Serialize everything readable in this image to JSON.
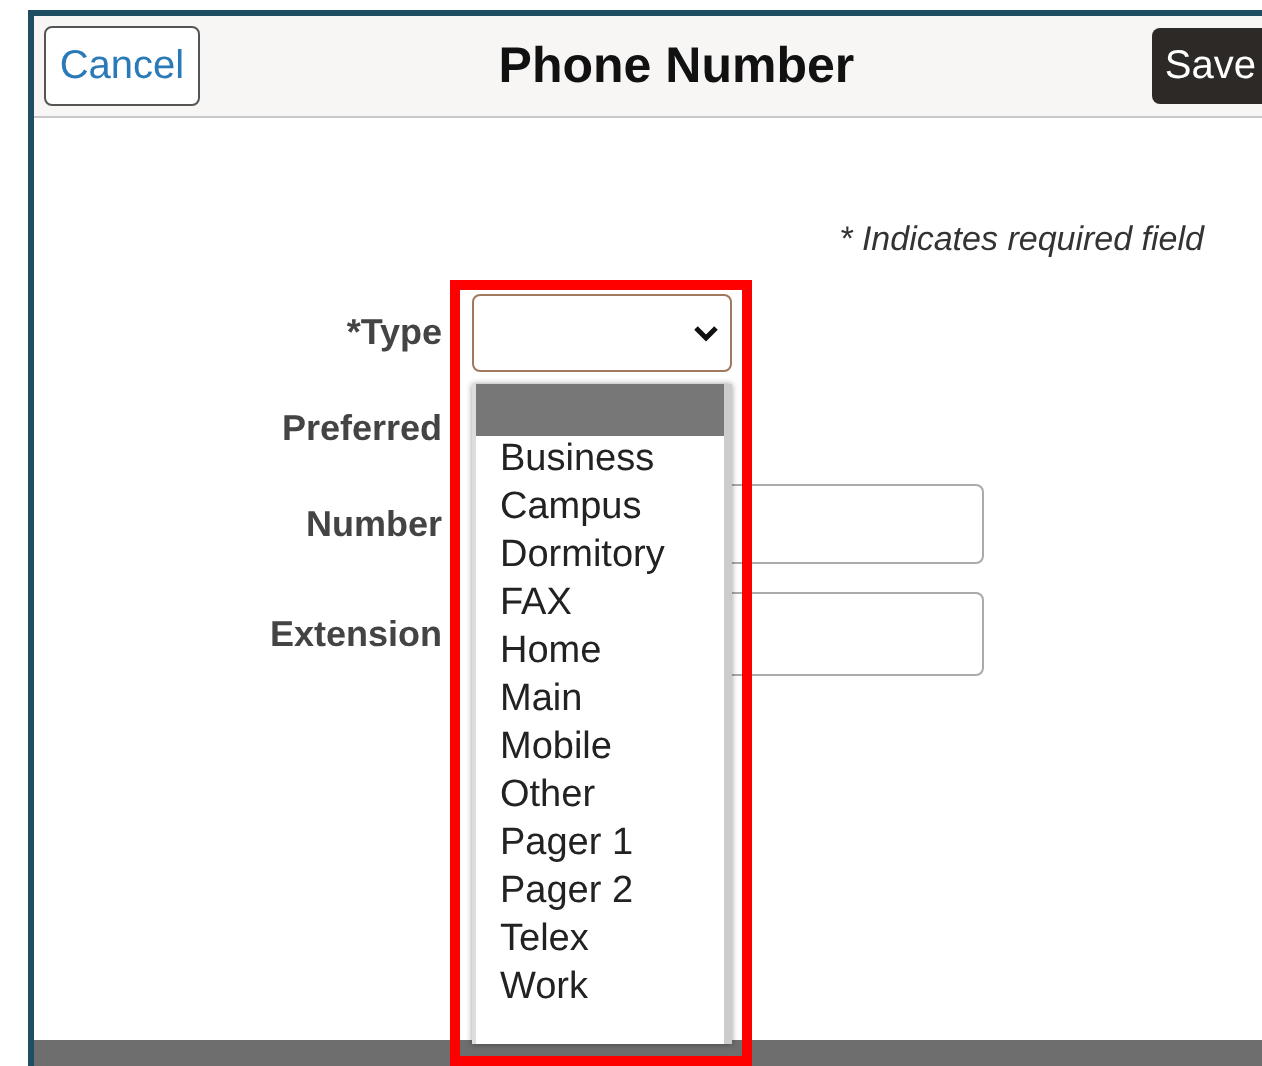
{
  "header": {
    "cancel": "Cancel",
    "title": "Phone Number",
    "save": "Save"
  },
  "required_note": "* Indicates required field",
  "fields": [
    {
      "label": "*Type",
      "kind": "select"
    },
    {
      "label": "Preferred",
      "kind": "none"
    },
    {
      "label": "Number",
      "kind": "text"
    },
    {
      "label": "Extension",
      "kind": "text"
    }
  ],
  "dropdown": {
    "blank_selected": true,
    "options": [
      {
        "label": "Business",
        "selected": false
      },
      {
        "label": "Campus",
        "selected": false
      },
      {
        "label": "Dormitory",
        "selected": false
      },
      {
        "label": "FAX",
        "selected": false
      },
      {
        "label": "Home",
        "selected": false
      },
      {
        "label": "Main",
        "selected": false
      },
      {
        "label": "Mobile",
        "selected": false
      },
      {
        "label": "Other",
        "selected": false
      },
      {
        "label": "Pager 1",
        "selected": false
      },
      {
        "label": "Pager 2",
        "selected": false
      },
      {
        "label": "Telex",
        "selected": false
      },
      {
        "label": "Work",
        "selected": false
      }
    ]
  }
}
